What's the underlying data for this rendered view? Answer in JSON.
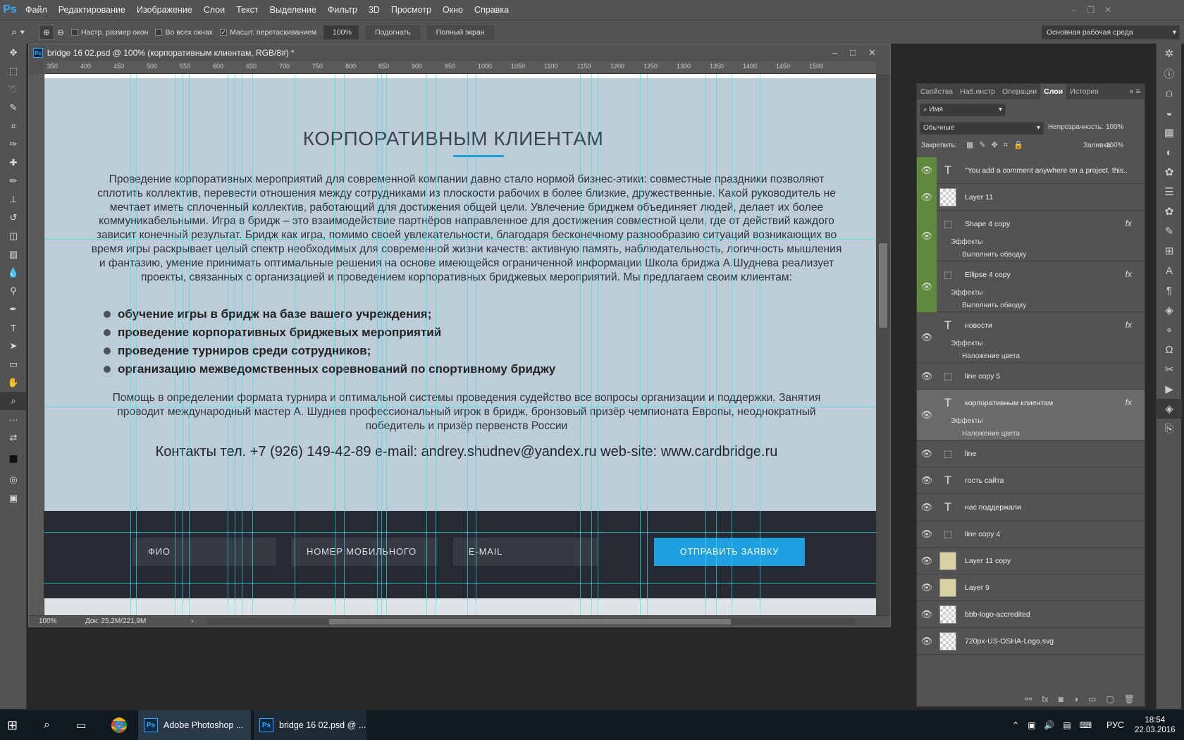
{
  "app": {
    "logo": "Ps",
    "window_controls": [
      "‒",
      "❐",
      "✕"
    ]
  },
  "menu": [
    "Файл",
    "Редактирование",
    "Изображение",
    "Слои",
    "Текст",
    "Выделение",
    "Фильтр",
    "3D",
    "Просмотр",
    "Окно",
    "Справка"
  ],
  "options": {
    "chk_resize": "Настр. размер окон",
    "chk_all": "Во всех окнах",
    "chk_scrubby": "Масшт. перетаскиванием",
    "zoom_value": "100%",
    "fit_btn": "Подогнать",
    "fullscreen_btn": "Полный экран",
    "workspace": "Основная рабочая среда"
  },
  "document": {
    "title": "bridge 16 02.psd @ 100% (корпоративным клиентам, RGB/8#) *",
    "status_zoom": "100%",
    "status_doc": "Док: 25,2M/221,9M",
    "ruler_labels": [
      "350",
      "400",
      "450",
      "500",
      "550",
      "600",
      "650",
      "700",
      "750",
      "800",
      "850",
      "900",
      "950",
      "1000",
      "1050",
      "1100",
      "1150",
      "1200",
      "1250",
      "1300",
      "1350",
      "1400",
      "1450",
      "1500"
    ]
  },
  "site": {
    "heading": "КОРПОРАТИВНЫМ КЛИЕНТАМ",
    "paragraph": "Проведение корпоративных мероприятий для современной компании давно стало нормой бизнес-этики: совместные праздники позволяют сплотить коллектив, перевести отношения между сотрудниками из плоскости рабочих в более близкие, дружественные. Какой руководитель не мечтает иметь сплоченный коллектив, работающий для достижения общей цели. Увлечение бриджем объединяет людей, делает их более коммуникабельными. Игра в бридж – это взаимодействие партнёров направленное для достижения совместной цели, где от действий каждого зависит конечный результат. Бридж как игра, помимо своей увлекательности, благодаря бесконечному разнообразию ситуаций возникающих во время игры раскрывает целый спектр необходимых для современной жизни качеств: активную память, наблюдательность, логичность мышления и фантазию, умение принимать оптимальные решения на основе имеющейся ограниченной информации Школа бриджа А.Шуднева реализует проекты, связанных с организацией и проведением корпоративных бриджевых мероприятий. Мы предлагаем своим клиентам:",
    "bullets": [
      "обучение игры в бридж на базе вашего учреждения;",
      "проведение корпоративных бриджевых мероприятий",
      "проведение турниров среди сотрудников;",
      "организацию межведомственных соревнований по спортивному бриджу"
    ],
    "paragraph2": "Помощь в определении формата турнира и оптимальной системы проведения судейство все вопросы организации и поддержки. Занятия проводит международный мастер А. Шуднев профессиональный игрок в бридж, бронзовый призёр чемпионата Европы, неоднократный победитель и призёр первенств России",
    "contacts": "Контакты тел. +7 (926) 149-42-89 e-mail: andrey.shudnev@yandex.ru web-site: www.cardbridge.ru",
    "form": {
      "name": "ФИО",
      "phone": "НОМЕР МОБИЛЬНОГО",
      "email": "E-MAIL",
      "submit": "ОТПРАВИТЬ ЗАЯВКУ"
    }
  },
  "panel": {
    "tabs": [
      "Свойства",
      "Наб.инстр",
      "Операции",
      "Слои",
      "История"
    ],
    "filter": "Имя",
    "blend": "Обычные",
    "opacity_label": "Непрозрачность:",
    "opacity": "100%",
    "lock_label": "Закрепить:",
    "fill_label": "Заливка:",
    "fill": "100%",
    "effects_label": "Эффекты",
    "layers": [
      {
        "name": "\"You add a comment anywhere on a project, this...",
        "kind": "text-warn",
        "green": true
      },
      {
        "name": "Layer 11",
        "kind": "raster",
        "green": true
      },
      {
        "name": "Shape 4 copy",
        "kind": "shape",
        "green": true,
        "fx": "fx",
        "effect": "Выполнить обводку"
      },
      {
        "name": "Ellipse 4 copy",
        "kind": "shape",
        "green": true,
        "fx": "fx",
        "effect": "Выполнить обводку"
      },
      {
        "name": "новости",
        "kind": "text-warn",
        "green": false,
        "fx": "fx",
        "effect": "Наложение цвета"
      },
      {
        "name": "line copy 5",
        "kind": "shape",
        "green": false
      },
      {
        "name": "корпоративным клиентам",
        "kind": "text-warn",
        "green": false,
        "fx": "fx",
        "effect": "Наложение цвета",
        "selected": true
      },
      {
        "name": "line",
        "kind": "shape",
        "green": false
      },
      {
        "name": "гость сайта",
        "kind": "text-warn",
        "green": false
      },
      {
        "name": "нас поддержали",
        "kind": "text-warn",
        "green": false
      },
      {
        "name": "line copy 4",
        "kind": "shape",
        "green": false
      },
      {
        "name": "Layer 11 copy",
        "kind": "image",
        "green": false
      },
      {
        "name": "Layer 9",
        "kind": "image",
        "green": false
      },
      {
        "name": "bbb-logo-accredited",
        "kind": "raster",
        "green": false
      },
      {
        "name": "720px-US-OSHA-Logo.svg",
        "kind": "raster",
        "green": false
      }
    ]
  },
  "taskbar": {
    "photoshop": "Adobe Photoshop ...",
    "doc": "bridge 16 02.psd @ ...",
    "lang": "РУС",
    "time": "18:54",
    "date": "22.03.2016"
  }
}
